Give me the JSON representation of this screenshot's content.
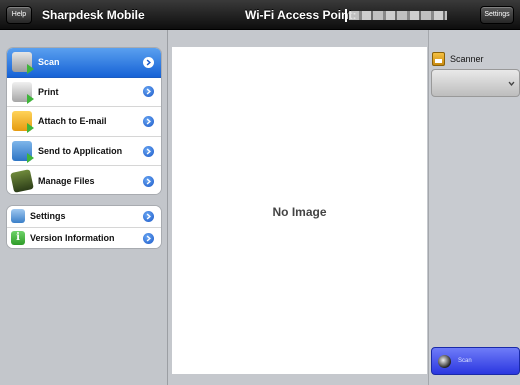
{
  "topbar": {
    "help_label": "Help",
    "app_title": "Sharpdesk Mobile",
    "ap_label": "Wi-Fi Access Point:",
    "settings_label": "Settings"
  },
  "sidebar": {
    "main_items": [
      {
        "label": "Scan",
        "icon": "scan-icon",
        "selected": true
      },
      {
        "label": "Print",
        "icon": "print-icon"
      },
      {
        "label": "Attach to E-mail",
        "icon": "mail-icon"
      },
      {
        "label": "Send to Application",
        "icon": "send-icon"
      },
      {
        "label": "Manage Files",
        "icon": "folder-icon"
      }
    ],
    "other_items": [
      {
        "label": "Settings",
        "icon": "gear-icon"
      },
      {
        "label": "Version Information",
        "icon": "info-icon"
      }
    ]
  },
  "preview": {
    "placeholder": "No Image"
  },
  "right_panel": {
    "scanner_label": "Scanner",
    "scan_button_label": "Scan"
  },
  "colors": {
    "selected_row": "#1662d6",
    "scan_button": "#2a36e0",
    "topbar": "#0d0d0d"
  }
}
